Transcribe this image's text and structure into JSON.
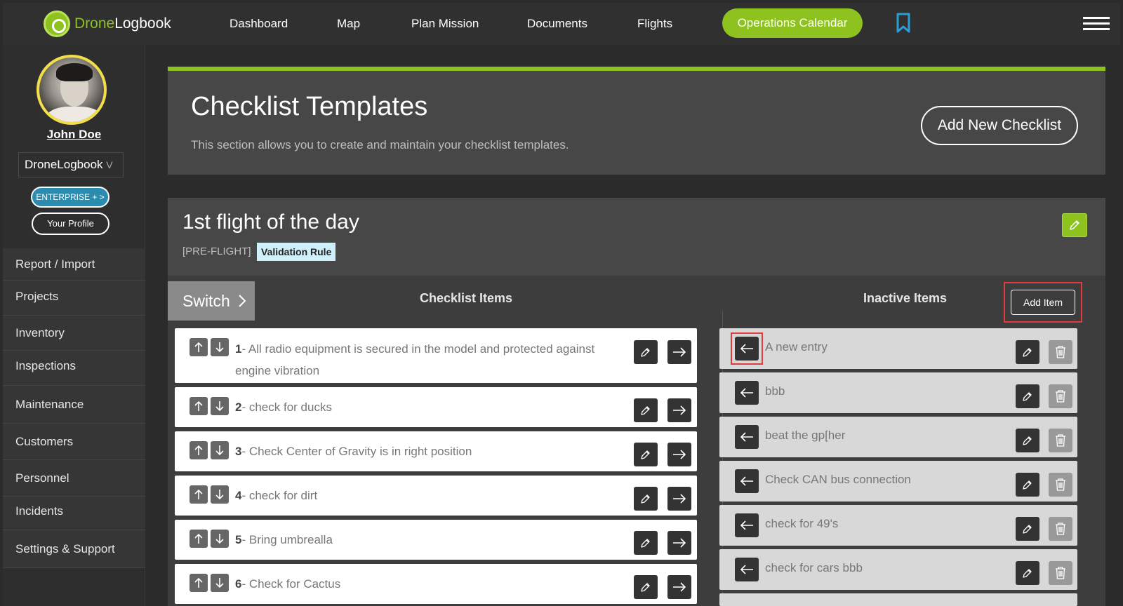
{
  "app": {
    "logo_part1": "Drone",
    "logo_part2": "Logbook"
  },
  "nav": {
    "items": [
      "Dashboard",
      "Map",
      "Plan Mission",
      "Documents",
      "Flights"
    ],
    "calendar": "Operations Calendar",
    "bookmark_icon": "bookmark-icon",
    "menu_icon": "hamburger-menu-icon"
  },
  "sidebar": {
    "user_name": "John Doe",
    "org_select": "DroneLogbook",
    "org_chevron": "V",
    "enterprise": "ENTERPRISE + >",
    "profile": "Your Profile",
    "menu": [
      "Report / Import",
      "Projects",
      "Inventory",
      "Inspections",
      "Maintenance",
      "Customers",
      "Personnel",
      "Incidents",
      "Settings & Support"
    ]
  },
  "header": {
    "title": "Checklist Templates",
    "subtitle": "This section allows you to create and maintain your checklist templates.",
    "add_new": "Add New Checklist"
  },
  "checklist": {
    "title": "1st flight of the day",
    "tag": "[PRE-FLIGHT]",
    "validation": "Validation Rule",
    "switch": "Switch",
    "items_heading": "Checklist Items",
    "inactive_heading": "Inactive Items",
    "add_item": "Add Item",
    "items": [
      {
        "num": "1",
        "text": "- All radio equipment is secured in the model and protected against engine vibration"
      },
      {
        "num": "2",
        "text": "- check for ducks"
      },
      {
        "num": "3",
        "text": "- Check Center of Gravity is in right position"
      },
      {
        "num": "4",
        "text": "- check for dirt"
      },
      {
        "num": "5",
        "text": "- Bring umbrealla"
      },
      {
        "num": "6",
        "text": "- Check for Cactus"
      }
    ],
    "inactive": [
      "A new entry",
      "bbb",
      "beat the gp[her",
      "Check CAN bus connection",
      "check for 49's",
      "check for cars bbb"
    ]
  },
  "colors": {
    "accent": "#8dc21f",
    "enterprise": "#2a8db0",
    "highlight": "#e03c3c",
    "badge": "#cfeffb"
  }
}
